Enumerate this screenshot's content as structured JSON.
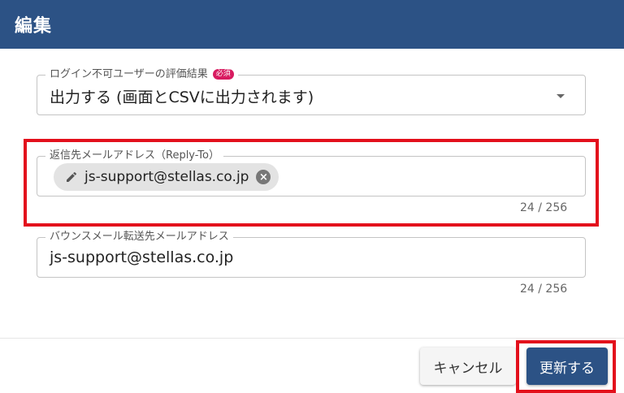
{
  "header": {
    "title": "編集"
  },
  "login_eval": {
    "label": "ログイン不可ユーザーの評価結果",
    "required_badge": "必須",
    "value": "出力する (画面とCSVに出力されます)"
  },
  "reply_to": {
    "label": "返信先メールアドレス（Reply-To）",
    "chip": "js-support@stellas.co.jp",
    "counter": "24 / 256"
  },
  "bounce": {
    "label": "バウンスメール転送先メールアドレス",
    "value": "js-support@stellas.co.jp",
    "counter": "24 / 256"
  },
  "buttons": {
    "cancel": "キャンセル",
    "update": "更新する"
  },
  "colors": {
    "header_bg": "#2c5285",
    "primary_button": "#2c5285",
    "highlight": "#e3101c",
    "required_badge": "#d81b60"
  }
}
